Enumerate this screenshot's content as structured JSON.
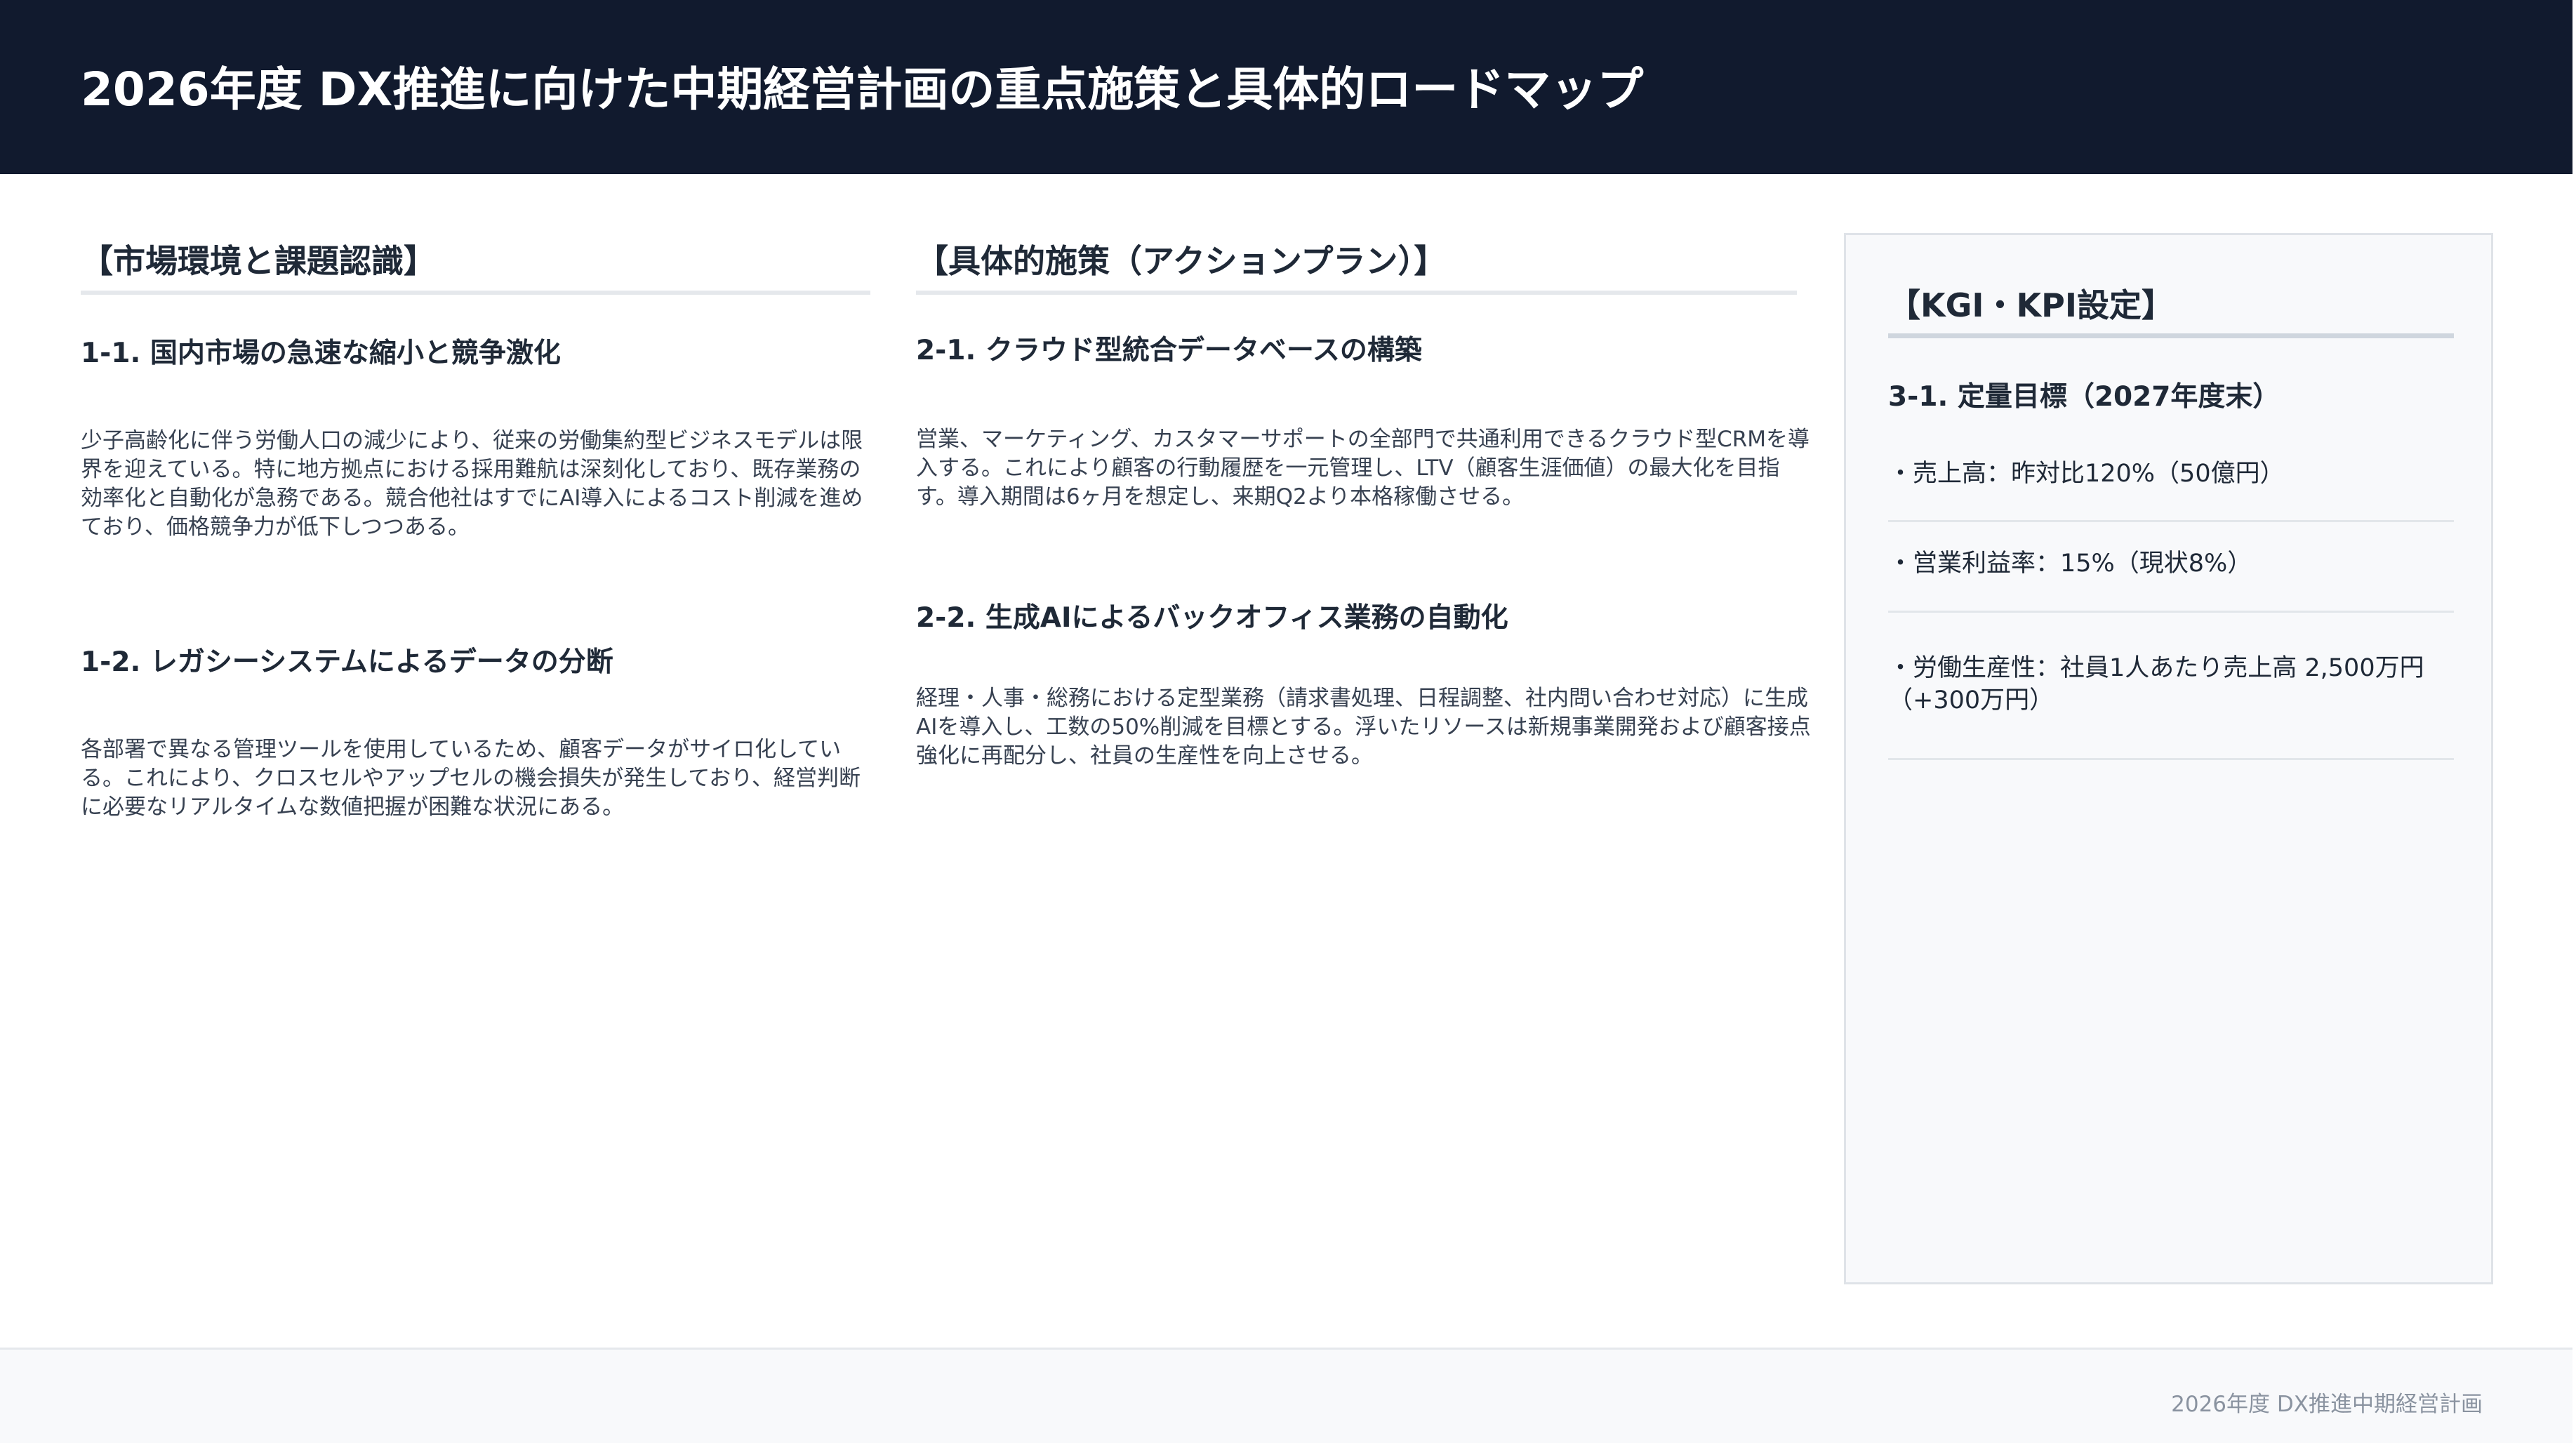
{
  "header": {
    "title": "2026年度 DX推進に向けた中期経営計画の重点施策と具体的ロードマップ"
  },
  "market": {
    "heading": "【市場環境と課題認識】",
    "items": [
      {
        "title": "1-1. 国内市場の急速な縮小と競争激化",
        "body": "少子高齢化に伴う労働人口の減少により、従来の労働集約型ビジネスモデルは限界を迎えている。特に地方拠点における採用難航は深刻化しており、既存業務の効率化と自動化が急務である。競合他社はすでにAI導入によるコスト削減を進めており、価格競争力が低下しつつある。"
      },
      {
        "title": "1-2. レガシーシステムによるデータの分断",
        "body": "各部署で異なる管理ツールを使用しているため、顧客データがサイロ化している。これにより、クロスセルやアップセルの機会損失が発生しており、経営判断に必要なリアルタイムな数値把握が困難な状況にある。"
      }
    ]
  },
  "actions": {
    "heading": "【具体的施策（アクションプラン）】",
    "items": [
      {
        "title": "2-1. クラウド型統合データベースの構築",
        "body": "営業、マーケティング、カスタマーサポートの全部門で共通利用できるクラウド型CRMを導入する。これにより顧客の行動履歴を一元管理し、LTV（顧客生涯価値）の最大化を目指す。導入期間は6ヶ月を想定し、来期Q2より本格稼働させる。"
      },
      {
        "title": "2-2. 生成AIによるバックオフィス業務の自動化",
        "body": "経理・人事・総務における定型業務（請求書処理、日程調整、社内問い合わせ対応）に生成AIを導入し、工数の50%削減を目標とする。浮いたリソースは新規事業開発および顧客接点強化に再配分し、社員の生産性を向上させる。"
      }
    ]
  },
  "kpi": {
    "heading": "【KGI・KPI設定】",
    "subheading": "3-1. 定量目標（2027年度末）",
    "items": [
      "・売上高：昨対比120%（50億円）",
      "・営業利益率：15%（現状8%）",
      "・労働生産性：社員1人あたり売上高 2,500万円（+300万円）"
    ]
  },
  "footer": {
    "text": "2026年度 DX推進中期経営計画"
  }
}
